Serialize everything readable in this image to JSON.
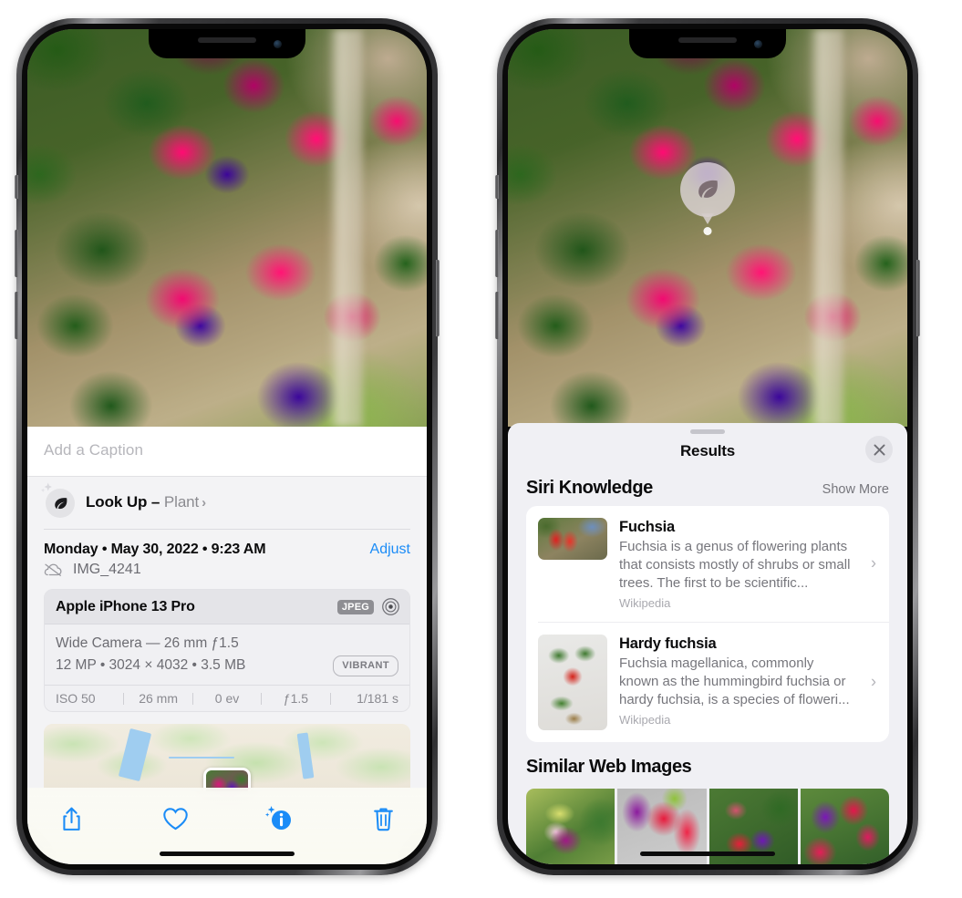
{
  "left_phone": {
    "caption": {
      "placeholder": "Add a Caption",
      "value": ""
    },
    "lookup": {
      "label": "Look Up – ",
      "subject": "Plant",
      "chevron": "›",
      "icon": "leaf-icon",
      "sparkle_icon": "sparkle-icon"
    },
    "meta": {
      "date": "Monday • May 30, 2022 • 9:23 AM",
      "adjust": "Adjust",
      "filename": "IMG_4241",
      "cloud_icon": "cloud-slash-icon"
    },
    "camera_card": {
      "device": "Apple iPhone 13 Pro",
      "format_badge": "JPEG",
      "aperture_icon": "aperture-icon",
      "lens": "Wide Camera — 26 mm ƒ1.5",
      "specs": "12 MP • 3024 × 4032 • 3.5 MB",
      "style_badge": "VIBRANT",
      "exif": [
        "ISO 50",
        "26 mm",
        "0 ev",
        "ƒ1.5",
        "1/181 s"
      ]
    },
    "toolbar": {
      "share": "share-icon",
      "favorite": "heart-icon",
      "info": "info-sparkle-icon",
      "delete": "trash-icon"
    },
    "accent_color": "#1b8cf7"
  },
  "right_phone": {
    "visual_lookup_badge": {
      "icon": "leaf-icon"
    },
    "sheet": {
      "title": "Results",
      "close": "close-icon",
      "siri_knowledge": {
        "heading": "Siri Knowledge",
        "show_more": "Show More",
        "items": [
          {
            "title": "Fuchsia",
            "description": "Fuchsia is a genus of flowering plants that consists mostly of shrubs or small trees. The first to be scientific...",
            "source": "Wikipedia",
            "chevron": "›",
            "thumb": "fuchsia-thumbnail"
          },
          {
            "title": "Hardy fuchsia",
            "description": "Fuchsia magellanica, commonly known as the hummingbird fuchsia or hardy fuchsia, is a species of floweri...",
            "source": "Wikipedia",
            "chevron": "›",
            "thumb": "hardy-fuchsia-thumbnail"
          }
        ]
      },
      "similar_web_images": {
        "heading": "Similar Web Images",
        "images": [
          "web-image-1",
          "web-image-2",
          "web-image-3",
          "web-image-4"
        ]
      }
    }
  }
}
